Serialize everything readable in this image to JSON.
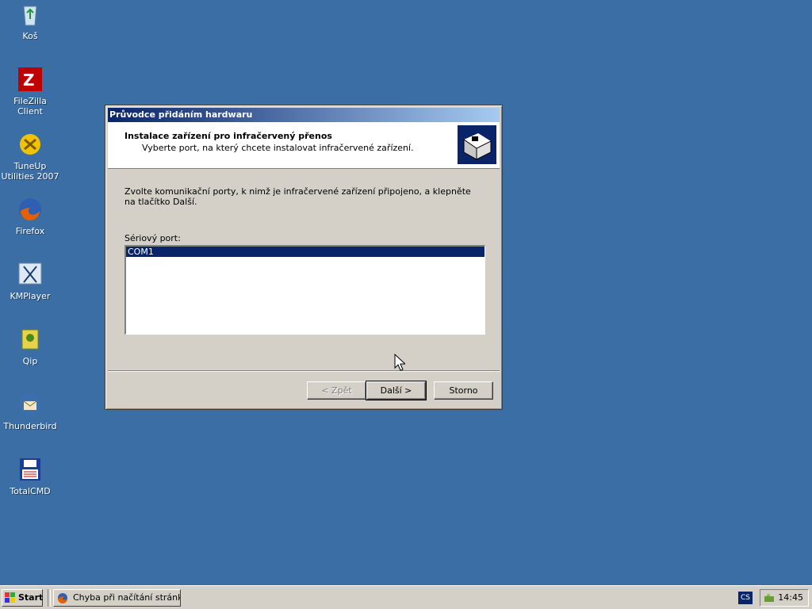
{
  "desktop": {
    "background_color": "#3a6ea5",
    "icons": [
      {
        "label": "Koš",
        "icon": "recycle-bin-icon"
      },
      {
        "label": "FileZilla Client",
        "icon": "filezilla-icon"
      },
      {
        "label": "TuneUp Utilities 2007",
        "icon": "tuneup-icon"
      },
      {
        "label": "Firefox",
        "icon": "firefox-icon"
      },
      {
        "label": "KMPlayer",
        "icon": "kmplayer-icon"
      },
      {
        "label": "Qip",
        "icon": "qip-icon"
      },
      {
        "label": "Thunderbird",
        "icon": "thunderbird-icon"
      },
      {
        "label": "TotalCMD",
        "icon": "totalcmd-icon"
      }
    ]
  },
  "dialog": {
    "title": "Průvodce přidáním hardwaru",
    "header_title": "Instalace zařízení pro infračervený přenos",
    "header_subtitle": "Vyberte port, na který chcete instalovat infračervené zařízení.",
    "instructions": "Zvolte komunikační porty, k nimž je infračervené zařízení připojeno, a klepněte na tlačítko Další.",
    "serial_port_label": "Sériový port:",
    "ports": [
      {
        "label": "COM1",
        "selected": true
      }
    ],
    "buttons": {
      "back": "< Zpět",
      "next": "Další >",
      "cancel": "Storno"
    }
  },
  "taskbar": {
    "start_label": "Start",
    "tasks": [
      {
        "label": "Chyba při načítání stránk...",
        "icon": "firefox-icon"
      }
    ],
    "language": "CS",
    "clock": "14:45"
  }
}
